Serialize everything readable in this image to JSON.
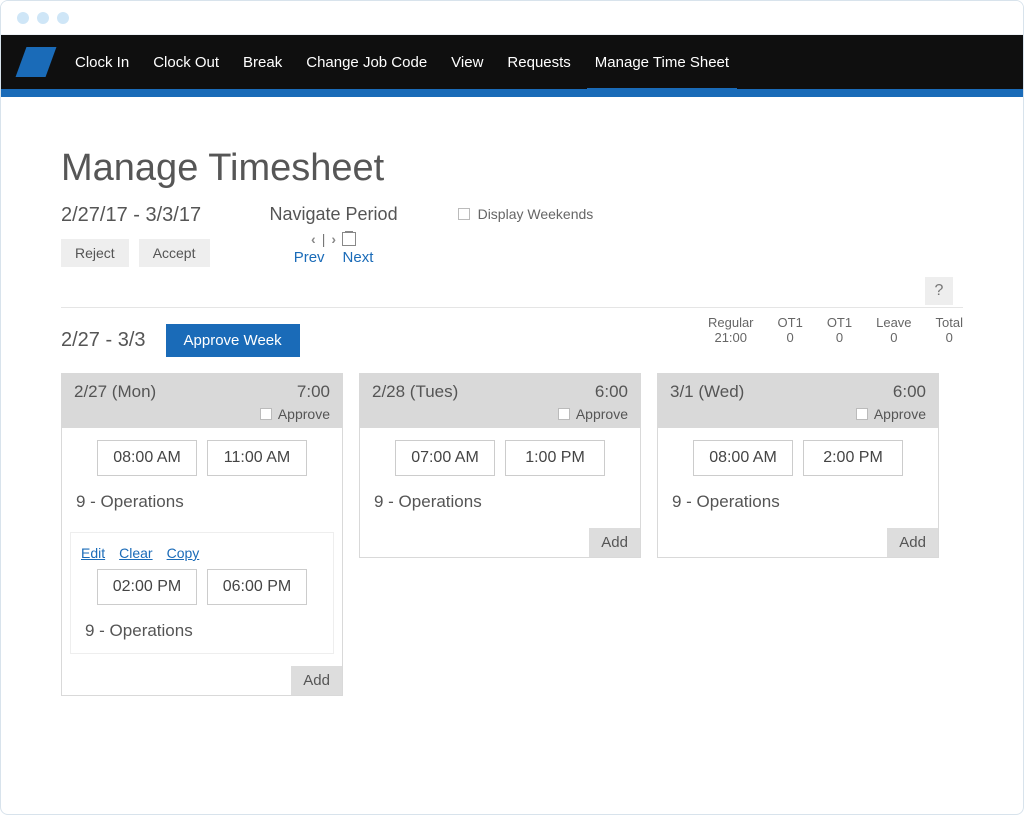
{
  "nav": {
    "items": [
      {
        "label": "Clock In"
      },
      {
        "label": "Clock Out"
      },
      {
        "label": "Break"
      },
      {
        "label": "Change Job Code"
      },
      {
        "label": "View"
      },
      {
        "label": "Requests"
      },
      {
        "label": "Manage Time Sheet"
      }
    ],
    "active_index": 6
  },
  "page": {
    "title": "Manage Timesheet",
    "help_label": "?",
    "period_range": "2/27/17 - 3/3/17",
    "navigate_label": "Navigate Period",
    "prev_label": "Prev",
    "next_label": "Next",
    "display_weekends_label": "Display Weekends",
    "reject_label": "Reject",
    "accept_label": "Accept"
  },
  "summary": [
    {
      "label": "Regular",
      "value": "21:00"
    },
    {
      "label": "OT1",
      "value": "0"
    },
    {
      "label": "OT1",
      "value": "0"
    },
    {
      "label": "Leave",
      "value": "0"
    },
    {
      "label": "Total",
      "value": "0"
    }
  ],
  "week": {
    "range": "2/27 - 3/3",
    "approve_week_label": "Approve Week"
  },
  "days": [
    {
      "date_label": "2/27 (Mon)",
      "hours": "7:00",
      "approve_label": "Approve",
      "entries": [
        {
          "start": "08:00 AM",
          "end": "11:00 AM",
          "job": "9 - Operations",
          "show_actions": false
        },
        {
          "start": "02:00 PM",
          "end": "06:00 PM",
          "job": "9 - Operations",
          "show_actions": true,
          "edit_label": "Edit",
          "clear_label": "Clear",
          "copy_label": "Copy"
        }
      ],
      "add_label": "Add"
    },
    {
      "date_label": "2/28 (Tues)",
      "hours": "6:00",
      "approve_label": "Approve",
      "entries": [
        {
          "start": "07:00 AM",
          "end": "1:00 PM",
          "job": "9 - Operations",
          "show_actions": false
        }
      ],
      "add_label": "Add"
    },
    {
      "date_label": "3/1 (Wed)",
      "hours": "6:00",
      "approve_label": "Approve",
      "entries": [
        {
          "start": "08:00 AM",
          "end": "2:00 PM",
          "job": "9 - Operations",
          "show_actions": false
        }
      ],
      "add_label": "Add"
    }
  ]
}
